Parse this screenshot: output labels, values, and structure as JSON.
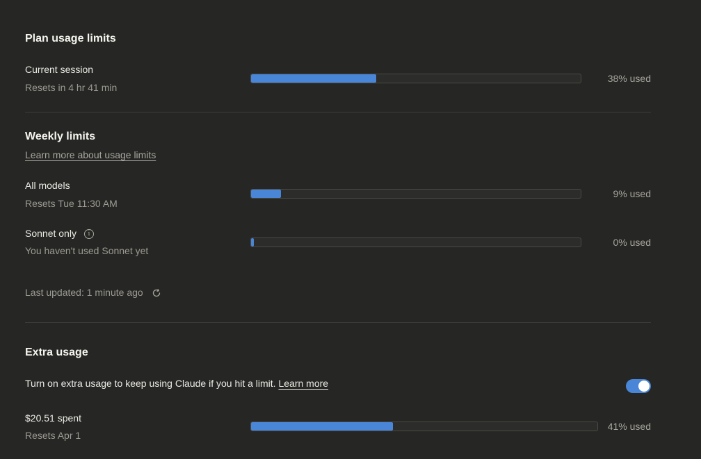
{
  "plan": {
    "title": "Plan usage limits",
    "current_session": {
      "label": "Current session",
      "resets": "Resets in 4 hr 41 min",
      "used_fraction": 0.38,
      "used_text": "38% used"
    }
  },
  "weekly": {
    "title": "Weekly limits",
    "learn_more": "Learn more about usage limits",
    "all_models": {
      "label": "All models",
      "resets": "Resets Tue 11:30 AM",
      "used_fraction": 0.09,
      "used_text": "9% used"
    },
    "sonnet": {
      "label": "Sonnet only",
      "info_icon": "info-icon",
      "sub": "You haven't used Sonnet yet",
      "used_fraction": 0.0,
      "used_text": "0% used"
    },
    "last_updated": "Last updated: 1 minute ago",
    "refresh_icon": "refresh-icon"
  },
  "extra": {
    "title": "Extra usage",
    "description": "Turn on extra usage to keep using Claude if you hit a limit.",
    "learn_more": "Learn more",
    "toggle_on": true,
    "spent": "$20.51 spent",
    "resets": "Resets Apr 1",
    "used_fraction": 0.41,
    "used_text": "41% used"
  },
  "colors": {
    "background": "#262624",
    "accent": "#4a86d8",
    "muted_text": "#9c9a93",
    "divider": "#3d3c38"
  }
}
